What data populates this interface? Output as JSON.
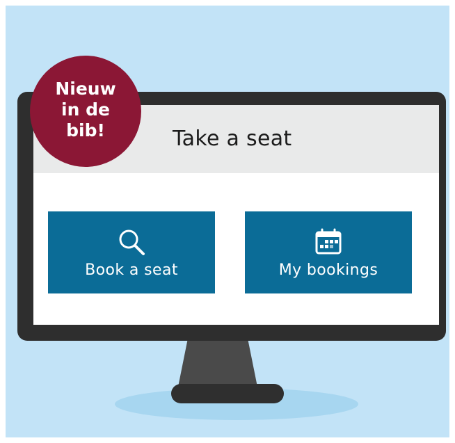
{
  "badge": {
    "lines": [
      "Nieuw",
      "in de",
      "bib!"
    ]
  },
  "app": {
    "title": "Take a seat"
  },
  "tiles": [
    {
      "label": "Book a seat",
      "icon": "search-icon"
    },
    {
      "label": "My bookings",
      "icon": "calendar-icon"
    }
  ],
  "colors": {
    "background": "#c2e3f7",
    "badge": "#8b1735",
    "tile": "#0b6c97",
    "header": "#e9eaea",
    "monitor": "#2e2e2e"
  }
}
